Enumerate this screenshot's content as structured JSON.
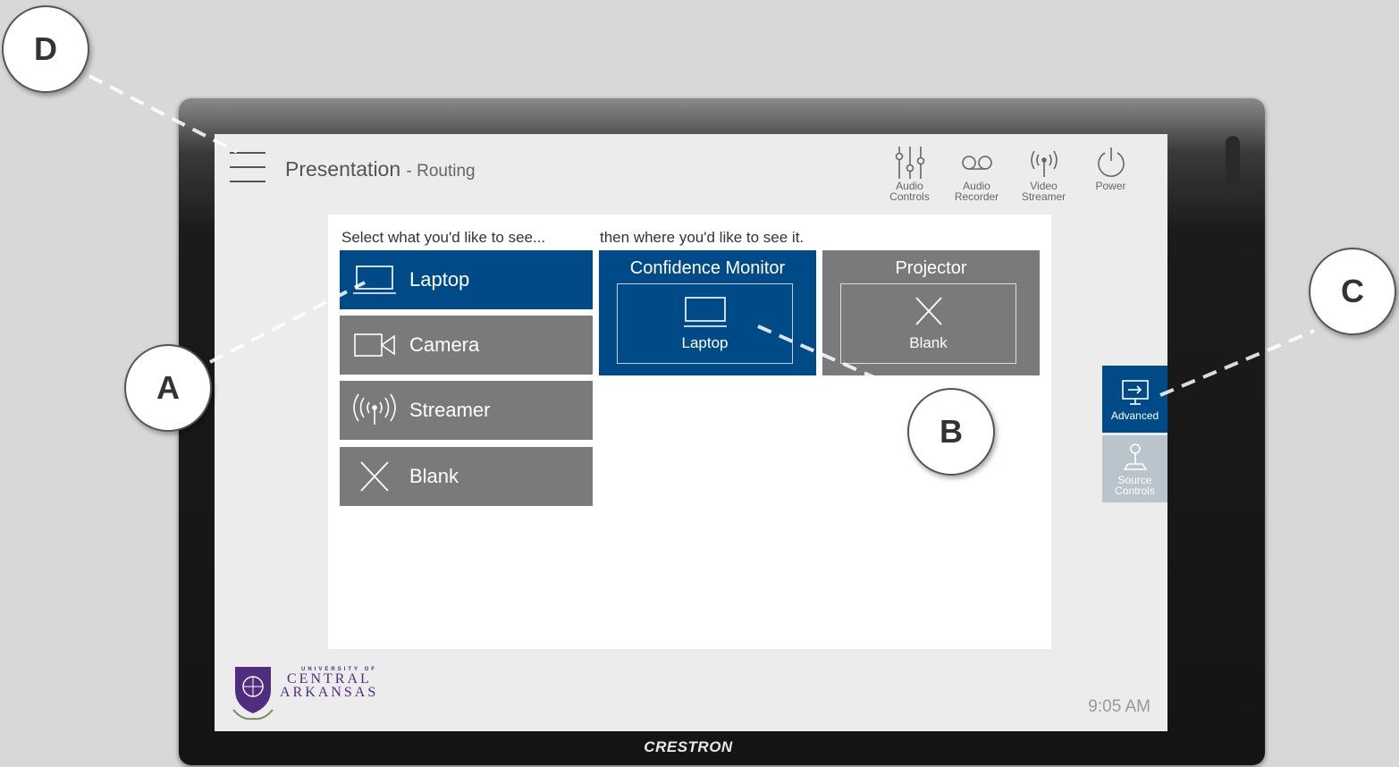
{
  "header": {
    "title": "Presentation",
    "subtitle": "- Routing"
  },
  "top_controls": [
    {
      "icon": "sliders-icon",
      "label": "Audio Controls"
    },
    {
      "icon": "voicemail-icon",
      "label": "Audio Recorder"
    },
    {
      "icon": "broadcast-icon",
      "label": "Video Streamer"
    },
    {
      "icon": "power-icon",
      "label": "Power"
    }
  ],
  "routing": {
    "source_hint": "Select what you'd like to see...",
    "dest_hint": "then where you'd like to see it.",
    "sources": [
      {
        "label": "Laptop",
        "icon": "laptop-icon",
        "selected": true
      },
      {
        "label": "Camera",
        "icon": "camera-icon",
        "selected": false
      },
      {
        "label": "Streamer",
        "icon": "broadcast-icon",
        "selected": false
      },
      {
        "label": "Blank",
        "icon": "x-icon",
        "selected": false
      }
    ],
    "destinations": [
      {
        "label": "Confidence Monitor",
        "current": "Laptop",
        "icon": "laptop-icon",
        "active": true
      },
      {
        "label": "Projector",
        "current": "Blank",
        "icon": "x-icon",
        "active": false
      }
    ]
  },
  "side_buttons": [
    {
      "label": "Advanced",
      "icon": "display-arrow-icon",
      "active": true
    },
    {
      "label": "Source Controls",
      "icon": "joystick-icon",
      "active": false
    }
  ],
  "logo": {
    "line1": "UNIVERSITY OF",
    "line2": "CENTRAL",
    "line3": "ARKANSAS"
  },
  "clock": "9:05 AM",
  "device_brand": "CRESTRON",
  "callouts": {
    "a": "A",
    "b": "B",
    "c": "C",
    "d": "D"
  },
  "colors": {
    "accent": "#004b87",
    "inactive": "#7a7a7a",
    "screen_bg": "#ececec"
  }
}
